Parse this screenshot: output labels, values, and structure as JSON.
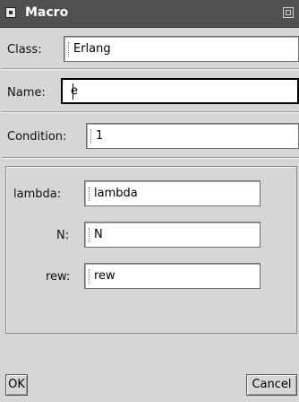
{
  "window": {
    "title": "Macro"
  },
  "form": {
    "class_label": "Class:",
    "class_value": "Erlang",
    "name_label": "Name:",
    "name_value": "e",
    "condition_label": "Condition:",
    "condition_value": "1"
  },
  "params": [
    {
      "label": "lambda:",
      "value": "lambda"
    },
    {
      "label": "N:",
      "value": "N"
    },
    {
      "label": "rew:",
      "value": "rew"
    }
  ],
  "buttons": {
    "ok": "OK",
    "cancel": "Cancel"
  }
}
